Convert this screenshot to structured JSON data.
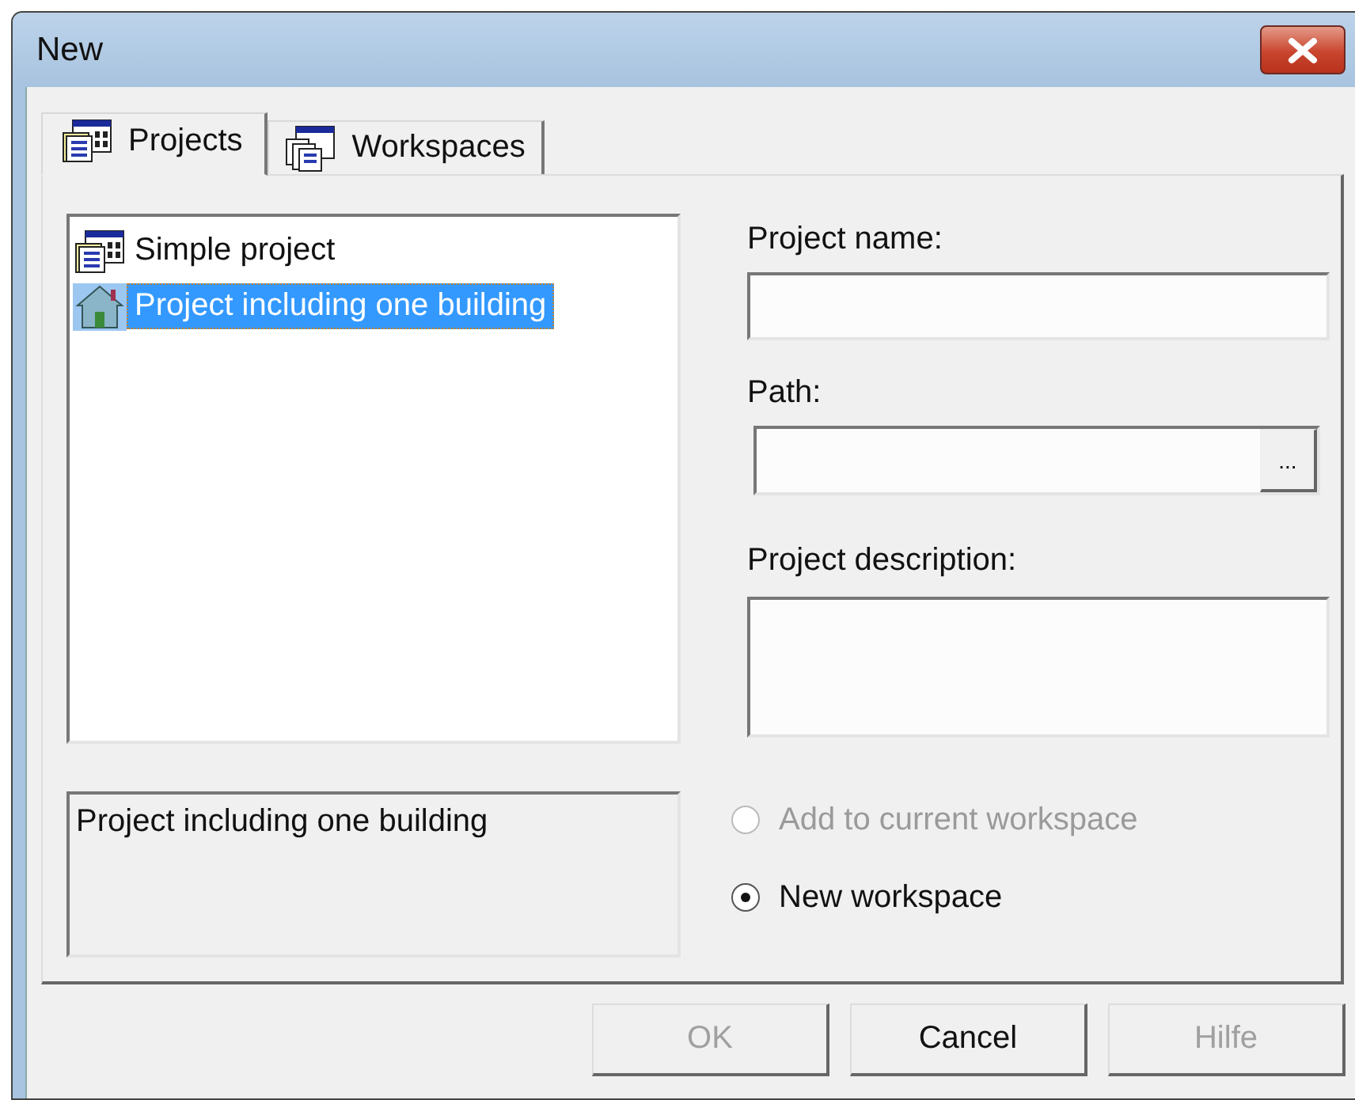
{
  "window": {
    "title": "New"
  },
  "tabs": [
    {
      "label": "Projects",
      "selected": true,
      "kind": "project"
    },
    {
      "label": "Workspaces",
      "selected": false,
      "kind": "workspace"
    }
  ],
  "project_types": [
    {
      "label": "Simple project",
      "selected": false,
      "kind": "project"
    },
    {
      "label": "Project including one building",
      "selected": true,
      "kind": "building"
    }
  ],
  "type_description": "Project including one building",
  "fields": [
    {
      "label": "Project name:",
      "kind": "text"
    },
    {
      "label": "Path:",
      "kind": "browse",
      "button": "..."
    },
    {
      "label": "Project description:",
      "kind": "multiline"
    }
  ],
  "workspace_options": [
    {
      "label": "Add to current workspace",
      "selected": false,
      "disabled": true
    },
    {
      "label": "New workspace",
      "selected": true,
      "disabled": false
    }
  ],
  "buttons": [
    {
      "label": "OK",
      "disabled": true
    },
    {
      "label": "Cancel",
      "disabled": false
    },
    {
      "label": "Hilfe",
      "disabled": true
    }
  ]
}
